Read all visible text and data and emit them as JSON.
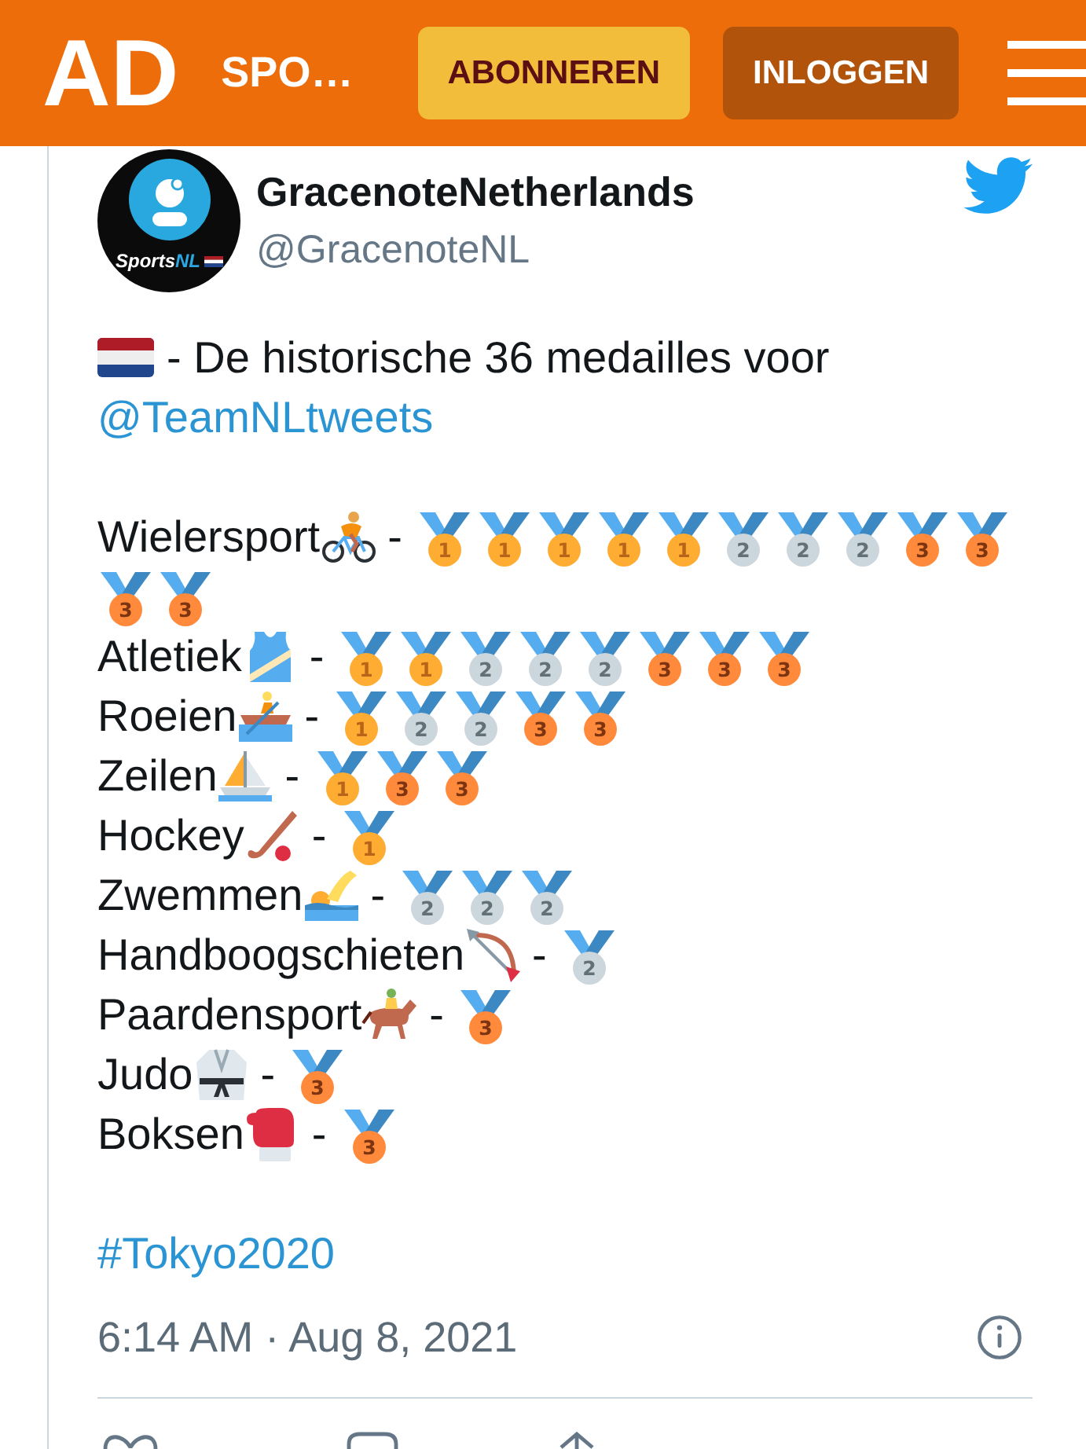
{
  "header": {
    "logo": "AD",
    "section": "SPO…",
    "buttons": [
      {
        "label": "ABONNEREN",
        "kind": "primary"
      },
      {
        "label": "INLOGGEN",
        "kind": "secondary"
      }
    ]
  },
  "tweet": {
    "author": {
      "name": "GracenoteNetherlands",
      "handle": "@GracenoteNL",
      "avatar": {
        "wordmark": "Sports",
        "wordmark_accent": "NL"
      }
    },
    "intro": {
      "text": "- De historische 36 medailles voor",
      "mention": "@TeamNLtweets"
    },
    "sports": [
      {
        "kind": "cycling",
        "name": "Wielersport",
        "separator": "-",
        "medals": [
          {
            "kind": "gold",
            "place": "1"
          },
          {
            "kind": "gold",
            "place": "1"
          },
          {
            "kind": "gold",
            "place": "1"
          },
          {
            "kind": "gold",
            "place": "1"
          },
          {
            "kind": "gold",
            "place": "1"
          },
          {
            "kind": "silver",
            "place": "2"
          },
          {
            "kind": "silver",
            "place": "2"
          },
          {
            "kind": "silver",
            "place": "2"
          },
          {
            "kind": "bronze",
            "place": "3"
          },
          {
            "kind": "bronze",
            "place": "3"
          },
          {
            "kind": "bronze",
            "place": "3"
          },
          {
            "kind": "bronze",
            "place": "3"
          }
        ]
      },
      {
        "kind": "athletics",
        "name": "Atletiek",
        "separator": "-",
        "medals": [
          {
            "kind": "gold",
            "place": "1"
          },
          {
            "kind": "gold",
            "place": "1"
          },
          {
            "kind": "silver",
            "place": "2"
          },
          {
            "kind": "silver",
            "place": "2"
          },
          {
            "kind": "silver",
            "place": "2"
          },
          {
            "kind": "bronze",
            "place": "3"
          },
          {
            "kind": "bronze",
            "place": "3"
          },
          {
            "kind": "bronze",
            "place": "3"
          }
        ]
      },
      {
        "kind": "rowing",
        "name": "Roeien",
        "separator": "-",
        "medals": [
          {
            "kind": "gold",
            "place": "1"
          },
          {
            "kind": "silver",
            "place": "2"
          },
          {
            "kind": "silver",
            "place": "2"
          },
          {
            "kind": "bronze",
            "place": "3"
          },
          {
            "kind": "bronze",
            "place": "3"
          }
        ]
      },
      {
        "kind": "sailing",
        "name": "Zeilen",
        "separator": "-",
        "medals": [
          {
            "kind": "gold",
            "place": "1"
          },
          {
            "kind": "bronze",
            "place": "3"
          },
          {
            "kind": "bronze",
            "place": "3"
          }
        ]
      },
      {
        "kind": "hockey",
        "name": "Hockey",
        "separator": "-",
        "medals": [
          {
            "kind": "gold",
            "place": "1"
          }
        ]
      },
      {
        "kind": "swimming",
        "name": "Zwemmen",
        "separator": "-",
        "medals": [
          {
            "kind": "silver",
            "place": "2"
          },
          {
            "kind": "silver",
            "place": "2"
          },
          {
            "kind": "silver",
            "place": "2"
          }
        ]
      },
      {
        "kind": "archery",
        "name": "Handboogschieten",
        "separator": "-",
        "medals": [
          {
            "kind": "silver",
            "place": "2"
          }
        ]
      },
      {
        "kind": "equestrian",
        "name": "Paardensport",
        "separator": "-",
        "medals": [
          {
            "kind": "bronze",
            "place": "3"
          }
        ]
      },
      {
        "kind": "judo",
        "name": "Judo",
        "separator": "-",
        "medals": [
          {
            "kind": "bronze",
            "place": "3"
          }
        ]
      },
      {
        "kind": "boxing",
        "name": "Boksen",
        "separator": "-",
        "medals": [
          {
            "kind": "bronze",
            "place": "3"
          }
        ]
      }
    ],
    "hashtag": "#Tokyo2020",
    "timestamp": "6:14 AM · Aug 8, 2021"
  }
}
